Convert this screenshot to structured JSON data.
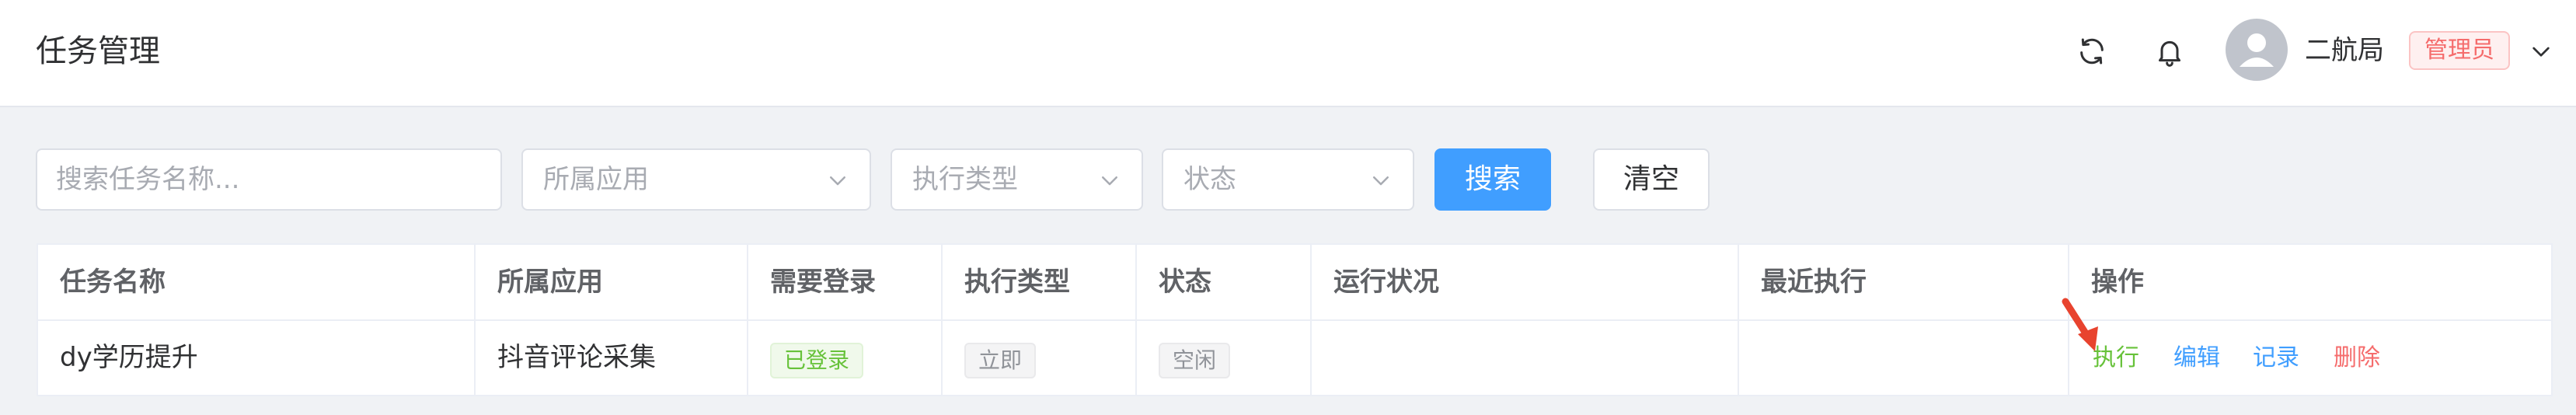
{
  "header": {
    "title": "任务管理",
    "icons": [
      "refresh-icon",
      "bell-icon"
    ],
    "user": {
      "name": "二航局",
      "role": "管理员"
    }
  },
  "filters": {
    "search_placeholder": "搜索任务名称...",
    "app_select": "所属应用",
    "type_select": "执行类型",
    "status_select": "状态",
    "search_button": "搜索",
    "clear_button": "清空"
  },
  "table": {
    "columns": [
      "任务名称",
      "所属应用",
      "需要登录",
      "执行类型",
      "状态",
      "运行状况",
      "最近执行",
      "操作"
    ],
    "rows": [
      {
        "name": "dy学历提升",
        "app": "抖音评论采集",
        "login": "已登录",
        "exec_type": "立即",
        "status": "空闲",
        "run_status": "",
        "last_run": "",
        "actions": [
          "执行",
          "编辑",
          "记录",
          "删除"
        ]
      }
    ]
  },
  "colors": {
    "primary": "#409eff",
    "success": "#67c23a",
    "danger": "#f56c6c",
    "info": "#909399",
    "annotation_arrow": "#e8432e"
  }
}
